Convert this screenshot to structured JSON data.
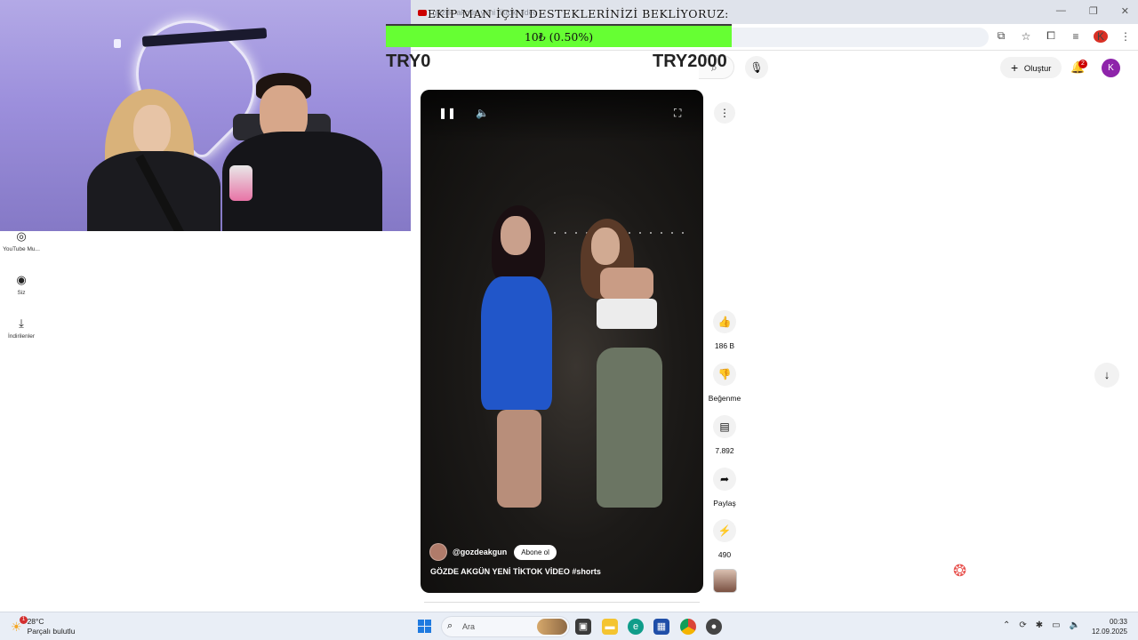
{
  "overlay": {
    "donation_title": "EKİP MAN İÇİN DESTEKLERİNİZİ BEKLİYORUZ:",
    "progress_text": "10₺ (0.50%)",
    "progress_fraction": 0.005,
    "range_min": "TRY0",
    "range_max": "TRY2000",
    "bar_color": "#66ff33"
  },
  "browser": {
    "tab_text": "gözde akgün yeni tiktok video",
    "icons": [
      "install-icon",
      "star-icon",
      "extensions-icon",
      "media-icon",
      "profile-icon",
      "menu-icon"
    ],
    "profile_initial": "K"
  },
  "sidebar": {
    "items": [
      {
        "icon": "youtube-music-icon",
        "label": "YouTube Mu..."
      },
      {
        "icon": "user-circle-icon",
        "label": "Siz"
      },
      {
        "icon": "download-icon",
        "label": "İndirilenler"
      }
    ]
  },
  "header": {
    "create_label": "Oluştur",
    "notification_count": "2",
    "avatar_initial": "K"
  },
  "short": {
    "channel": "@gozdeakgun",
    "subscribe_label": "Abone ol",
    "title": "GÖZDE AKGÜN YENİ TİKTOK VİDEO #shorts"
  },
  "actions": {
    "like_count": "186 B",
    "dislike_label": "Beğenme",
    "comment_count": "7.892",
    "share_label": "Paylaş",
    "remix_count": "490"
  },
  "taskbar": {
    "temperature": "28°C",
    "weather_desc": "Parçalı bulutlu",
    "weather_badge": "1",
    "search_placeholder": "Ara",
    "time": "00:33",
    "date": "12.09.2025"
  }
}
